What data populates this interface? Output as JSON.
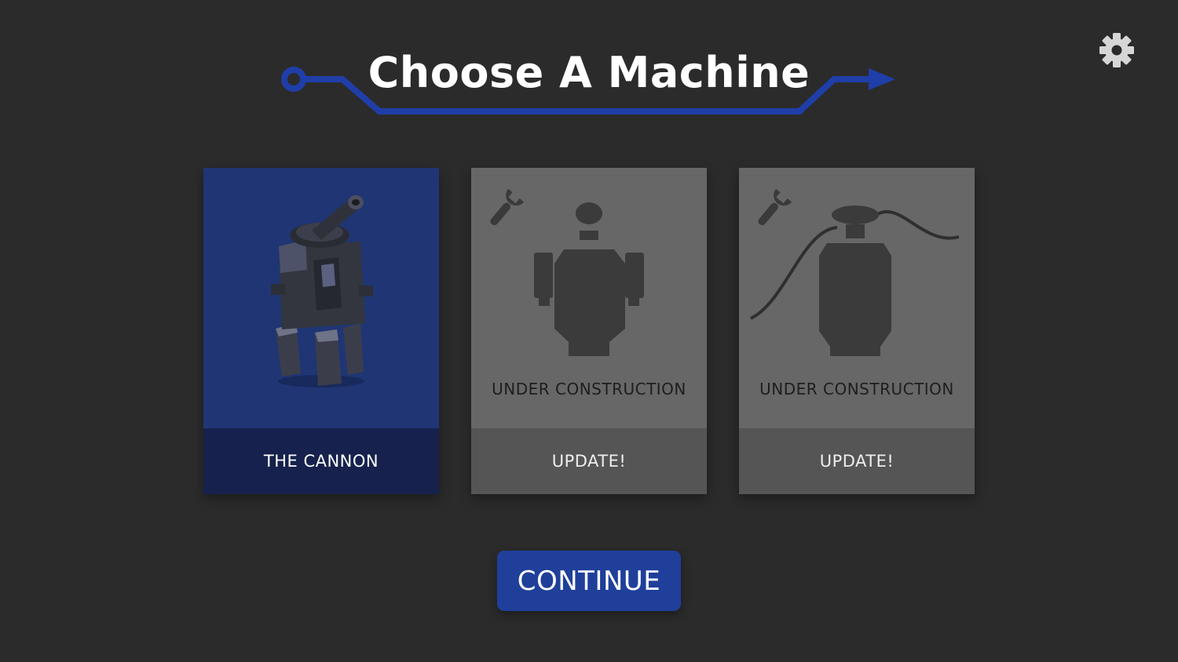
{
  "title": "Choose A Machine",
  "settings": {
    "icon": "gear-icon"
  },
  "colors": {
    "background": "#2b2b2c",
    "accent_blue": "#1f3f9a",
    "selected_card": "#203574",
    "selected_footer": "#16224d",
    "locked_card": "#676767",
    "locked_footer": "#555556"
  },
  "machines": [
    {
      "name": "THE CANNON",
      "state": "selected",
      "icon": "cannon-machine-icon"
    },
    {
      "status": "UNDER CONSTRUCTION",
      "action": "UPDATE!",
      "state": "locked",
      "icon": "wrench-icon"
    },
    {
      "status": "UNDER CONSTRUCTION",
      "action": "UPDATE!",
      "state": "locked",
      "icon": "wrench-icon"
    }
  ],
  "continue_label": "CONTINUE"
}
